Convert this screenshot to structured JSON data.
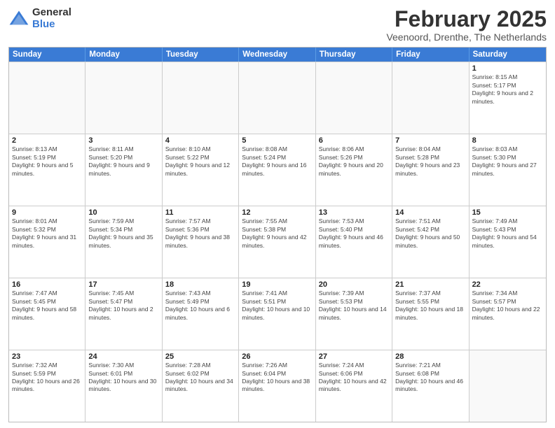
{
  "header": {
    "logo_general": "General",
    "logo_blue": "Blue",
    "title": "February 2025",
    "subtitle": "Veenoord, Drenthe, The Netherlands"
  },
  "days_of_week": [
    "Sunday",
    "Monday",
    "Tuesday",
    "Wednesday",
    "Thursday",
    "Friday",
    "Saturday"
  ],
  "rows": [
    [
      {
        "day": "",
        "info": ""
      },
      {
        "day": "",
        "info": ""
      },
      {
        "day": "",
        "info": ""
      },
      {
        "day": "",
        "info": ""
      },
      {
        "day": "",
        "info": ""
      },
      {
        "day": "",
        "info": ""
      },
      {
        "day": "1",
        "info": "Sunrise: 8:15 AM\nSunset: 5:17 PM\nDaylight: 9 hours and 2 minutes."
      }
    ],
    [
      {
        "day": "2",
        "info": "Sunrise: 8:13 AM\nSunset: 5:19 PM\nDaylight: 9 hours and 5 minutes."
      },
      {
        "day": "3",
        "info": "Sunrise: 8:11 AM\nSunset: 5:20 PM\nDaylight: 9 hours and 9 minutes."
      },
      {
        "day": "4",
        "info": "Sunrise: 8:10 AM\nSunset: 5:22 PM\nDaylight: 9 hours and 12 minutes."
      },
      {
        "day": "5",
        "info": "Sunrise: 8:08 AM\nSunset: 5:24 PM\nDaylight: 9 hours and 16 minutes."
      },
      {
        "day": "6",
        "info": "Sunrise: 8:06 AM\nSunset: 5:26 PM\nDaylight: 9 hours and 20 minutes."
      },
      {
        "day": "7",
        "info": "Sunrise: 8:04 AM\nSunset: 5:28 PM\nDaylight: 9 hours and 23 minutes."
      },
      {
        "day": "8",
        "info": "Sunrise: 8:03 AM\nSunset: 5:30 PM\nDaylight: 9 hours and 27 minutes."
      }
    ],
    [
      {
        "day": "9",
        "info": "Sunrise: 8:01 AM\nSunset: 5:32 PM\nDaylight: 9 hours and 31 minutes."
      },
      {
        "day": "10",
        "info": "Sunrise: 7:59 AM\nSunset: 5:34 PM\nDaylight: 9 hours and 35 minutes."
      },
      {
        "day": "11",
        "info": "Sunrise: 7:57 AM\nSunset: 5:36 PM\nDaylight: 9 hours and 38 minutes."
      },
      {
        "day": "12",
        "info": "Sunrise: 7:55 AM\nSunset: 5:38 PM\nDaylight: 9 hours and 42 minutes."
      },
      {
        "day": "13",
        "info": "Sunrise: 7:53 AM\nSunset: 5:40 PM\nDaylight: 9 hours and 46 minutes."
      },
      {
        "day": "14",
        "info": "Sunrise: 7:51 AM\nSunset: 5:42 PM\nDaylight: 9 hours and 50 minutes."
      },
      {
        "day": "15",
        "info": "Sunrise: 7:49 AM\nSunset: 5:43 PM\nDaylight: 9 hours and 54 minutes."
      }
    ],
    [
      {
        "day": "16",
        "info": "Sunrise: 7:47 AM\nSunset: 5:45 PM\nDaylight: 9 hours and 58 minutes."
      },
      {
        "day": "17",
        "info": "Sunrise: 7:45 AM\nSunset: 5:47 PM\nDaylight: 10 hours and 2 minutes."
      },
      {
        "day": "18",
        "info": "Sunrise: 7:43 AM\nSunset: 5:49 PM\nDaylight: 10 hours and 6 minutes."
      },
      {
        "day": "19",
        "info": "Sunrise: 7:41 AM\nSunset: 5:51 PM\nDaylight: 10 hours and 10 minutes."
      },
      {
        "day": "20",
        "info": "Sunrise: 7:39 AM\nSunset: 5:53 PM\nDaylight: 10 hours and 14 minutes."
      },
      {
        "day": "21",
        "info": "Sunrise: 7:37 AM\nSunset: 5:55 PM\nDaylight: 10 hours and 18 minutes."
      },
      {
        "day": "22",
        "info": "Sunrise: 7:34 AM\nSunset: 5:57 PM\nDaylight: 10 hours and 22 minutes."
      }
    ],
    [
      {
        "day": "23",
        "info": "Sunrise: 7:32 AM\nSunset: 5:59 PM\nDaylight: 10 hours and 26 minutes."
      },
      {
        "day": "24",
        "info": "Sunrise: 7:30 AM\nSunset: 6:01 PM\nDaylight: 10 hours and 30 minutes."
      },
      {
        "day": "25",
        "info": "Sunrise: 7:28 AM\nSunset: 6:02 PM\nDaylight: 10 hours and 34 minutes."
      },
      {
        "day": "26",
        "info": "Sunrise: 7:26 AM\nSunset: 6:04 PM\nDaylight: 10 hours and 38 minutes."
      },
      {
        "day": "27",
        "info": "Sunrise: 7:24 AM\nSunset: 6:06 PM\nDaylight: 10 hours and 42 minutes."
      },
      {
        "day": "28",
        "info": "Sunrise: 7:21 AM\nSunset: 6:08 PM\nDaylight: 10 hours and 46 minutes."
      },
      {
        "day": "",
        "info": ""
      }
    ]
  ]
}
